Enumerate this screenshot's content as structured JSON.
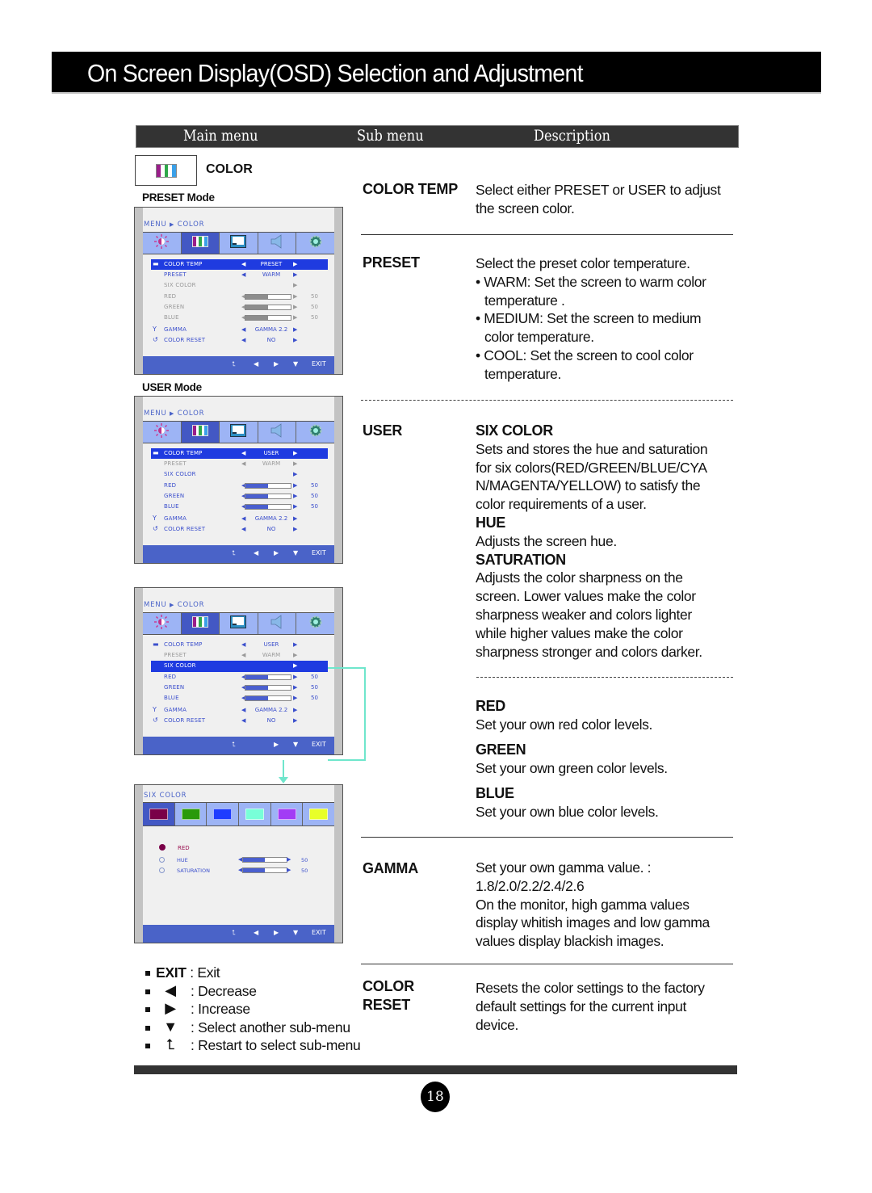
{
  "page_title": "On Screen Display(OSD) Selection and Adjustment",
  "column_headers": {
    "main": "Main menu",
    "sub": "Sub menu",
    "desc": "Description"
  },
  "main_menu": {
    "label": "COLOR",
    "icon": "color-bars-icon"
  },
  "modes": {
    "preset": "PRESET Mode",
    "user": "USER Mode"
  },
  "osd": {
    "breadcrumb_menu": "MENU",
    "breadcrumb_sep": "▶",
    "breadcrumb_item": "COLOR",
    "tabs": [
      "picture-icon",
      "color-bars-icon",
      "display-icon",
      "speaker-icon",
      "gear-icon"
    ],
    "footer": {
      "up": "⮤",
      "left": "◀",
      "right": "▶",
      "down": "▼",
      "exit": "EXIT"
    },
    "preset_screen": {
      "rows": [
        {
          "label": "COLOR TEMP",
          "value": "PRESET",
          "state": "selected",
          "prefix": "▬"
        },
        {
          "label": "PRESET",
          "value": "WARM",
          "state": "normal"
        },
        {
          "label": "SIX COLOR",
          "value": "",
          "state": "dim"
        },
        {
          "label": "RED",
          "slider": 0.5,
          "num": "50",
          "state": "dim"
        },
        {
          "label": "GREEN",
          "slider": 0.5,
          "num": "50",
          "state": "dim"
        },
        {
          "label": "BLUE",
          "slider": 0.5,
          "num": "50",
          "state": "dim"
        },
        {
          "label": "GAMMA",
          "value": "GAMMA 2.2",
          "state": "normal",
          "prefix": "Y"
        },
        {
          "label": "COLOR RESET",
          "value": "NO",
          "state": "normal",
          "prefix": "↺"
        }
      ]
    },
    "user_screen": {
      "rows": [
        {
          "label": "COLOR TEMP",
          "value": "USER",
          "state": "selected",
          "prefix": "▬"
        },
        {
          "label": "PRESET",
          "value": "WARM",
          "state": "dim"
        },
        {
          "label": "SIX COLOR",
          "value": "",
          "state": "normal"
        },
        {
          "label": "RED",
          "slider": 0.5,
          "num": "50",
          "state": "normal"
        },
        {
          "label": "GREEN",
          "slider": 0.5,
          "num": "50",
          "state": "normal"
        },
        {
          "label": "BLUE",
          "slider": 0.5,
          "num": "50",
          "state": "normal"
        },
        {
          "label": "GAMMA",
          "value": "GAMMA 2.2",
          "state": "normal",
          "prefix": "Y"
        },
        {
          "label": "COLOR RESET",
          "value": "NO",
          "state": "normal",
          "prefix": "↺"
        }
      ]
    },
    "six_color_select_screen": {
      "rows": [
        {
          "label": "COLOR TEMP",
          "value": "USER",
          "state": "normal",
          "prefix": "▬"
        },
        {
          "label": "PRESET",
          "value": "WARM",
          "state": "dim"
        },
        {
          "label": "SIX COLOR",
          "value": "",
          "state": "selected"
        },
        {
          "label": "RED",
          "slider": 0.5,
          "num": "50",
          "state": "normal"
        },
        {
          "label": "GREEN",
          "slider": 0.5,
          "num": "50",
          "state": "normal"
        },
        {
          "label": "BLUE",
          "slider": 0.5,
          "num": "50",
          "state": "normal"
        },
        {
          "label": "GAMMA",
          "value": "GAMMA 2.2",
          "state": "normal",
          "prefix": "Y"
        },
        {
          "label": "COLOR RESET",
          "value": "NO",
          "state": "normal",
          "prefix": "↺"
        }
      ]
    },
    "six_color_screen": {
      "title": "SIX COLOR",
      "swatches": [
        "#7a0048",
        "#2a9a0a",
        "#1e3cff",
        "#78ffd8",
        "#a23cf5",
        "#e8ff2a"
      ],
      "selected_color": "RED",
      "rows": [
        {
          "label": "HUE",
          "slider": 0.5,
          "num": "50"
        },
        {
          "label": "SATURATION",
          "slider": 0.5,
          "num": "50"
        }
      ]
    }
  },
  "legend": [
    {
      "icon": "",
      "bold": "EXIT",
      "text": " : Exit"
    },
    {
      "icon": "◀",
      "text": ": Decrease"
    },
    {
      "icon": "▶",
      "text": ": Increase"
    },
    {
      "icon": "▼",
      "text": ": Select another sub-menu"
    },
    {
      "icon": "⮤",
      "text": ": Restart to select sub-menu"
    }
  ],
  "sections": {
    "color_temp": {
      "label": "COLOR TEMP",
      "lines": [
        "Select either PRESET or USER to adjust",
        "the screen color."
      ]
    },
    "preset": {
      "label": "PRESET",
      "intro": "Select the preset color temperature.",
      "bullets": [
        [
          "• WARM: Set the screen to warm color",
          "temperature ."
        ],
        [
          "• MEDIUM: Set the screen to medium",
          "color temperature."
        ],
        [
          "• COOL: Set the screen to cool color",
          "temperature."
        ]
      ]
    },
    "user": {
      "label": "USER",
      "six_color": {
        "heading": "SIX COLOR",
        "lines": [
          "Sets and stores the hue and saturation",
          "for six colors(RED/GREEN/BLUE/CYA",
          "N/MAGENTA/YELLOW) to satisfy the",
          "color requirements of a user."
        ]
      },
      "hue": {
        "heading": "HUE",
        "lines": [
          "Adjusts the screen hue."
        ]
      },
      "saturation": {
        "heading": "SATURATION",
        "lines": [
          "Adjusts the color sharpness on the",
          "screen. Lower values make the color",
          "sharpness weaker and colors lighter",
          "while higher values make the color",
          "sharpness stronger and colors darker."
        ]
      },
      "red": {
        "heading": "RED",
        "lines": [
          "Set your own red color levels."
        ]
      },
      "green": {
        "heading": "GREEN",
        "lines": [
          "Set your own green color levels."
        ]
      },
      "blue": {
        "heading": "BLUE",
        "lines": [
          "Set your own blue color levels."
        ]
      }
    },
    "gamma": {
      "label": "GAMMA",
      "lines": [
        "Set your own gamma value. :",
        "1.8/2.0/2.2/2.4/2.6",
        "On the monitor, high gamma values",
        "display whitish images and low gamma",
        "values display blackish images."
      ]
    },
    "color_reset": {
      "label_1": "COLOR",
      "label_2": "RESET",
      "lines": [
        "Resets the color settings to the factory",
        "default settings for the current input",
        "device."
      ]
    }
  },
  "page_number": "18",
  "colors": {
    "osd_blue": "#4a63c8",
    "osd_select": "#1f3be0",
    "osd_tab": "#9db4f5",
    "connector": "#6fe6cc"
  }
}
